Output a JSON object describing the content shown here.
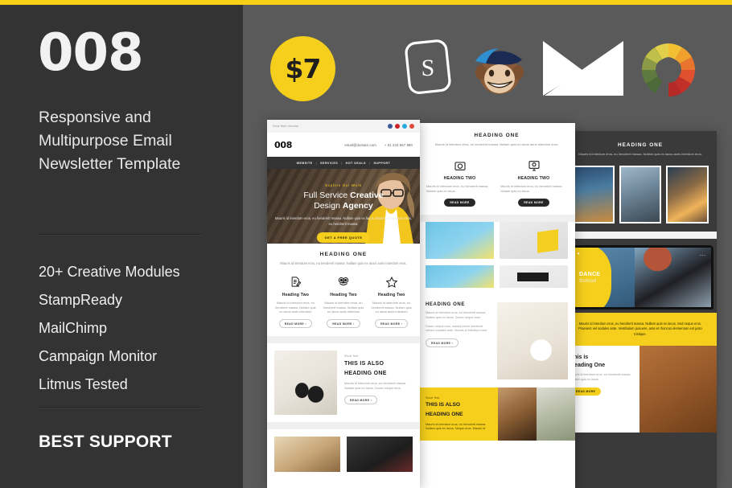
{
  "colors": {
    "accent_yellow": "#f5cf1b",
    "left_panel_bg": "#333333",
    "right_panel_bg": "#5a5a5a",
    "text_light": "#e8e8e8"
  },
  "left_panel": {
    "product_number": "008",
    "tagline": "Responsive and Multipurpose Email Newsletter Template",
    "features": [
      "20+ Creative Modules",
      "StampReady",
      "MailChimp",
      "Campaign Monitor",
      "Litmus Tested"
    ],
    "support_label": "BEST SUPPORT"
  },
  "badges": [
    {
      "name": "price-badge",
      "label": "$7"
    },
    {
      "name": "stampready-badge",
      "label": "S"
    },
    {
      "name": "mailchimp-badge",
      "label": "MailChimp"
    },
    {
      "name": "campaign-monitor-badge",
      "label": "Campaign Monitor"
    },
    {
      "name": "litmus-badge",
      "label": "Litmus"
    }
  ],
  "preview": {
    "main_sheet": {
      "preheader": "View Web Version",
      "social": [
        "facebook",
        "pinterest",
        "twitter",
        "google-plus"
      ],
      "logo": "008",
      "email": "email@domain.com",
      "phone": "+ 01 234 567 890",
      "nav": [
        "WEBSITE",
        "SERVICES",
        "HOT DEALS",
        "SUPPORT"
      ],
      "nav_separator": "|",
      "hero": {
        "eyebrow": "Explore Our Work",
        "title_line1_regular": "Full Service ",
        "title_line1_bold": "Creative",
        "title_line2_regular": "Design ",
        "title_line2_bold": "Agency",
        "body": "Mauris id interdum eros, eu hendrerit massa. Nullam quis ex lacus. Mauris id interdum eros, eu hendrerit massa.",
        "cta": "GET A FREE QUOTE"
      },
      "section": {
        "heading": "HEADING ONE",
        "sub": "Mauris id interdum eros, eu hendrerit massa. Nullam quis ex lacus auris interdum eros.",
        "columns": [
          {
            "icon": "document-pencil-icon",
            "heading": "Heading Two",
            "body": "Mauris id interdum eros, eu hendrerit massa. Nullam quis ex lacus auris interdum",
            "button": "READ MORE  ›"
          },
          {
            "icon": "owl-icon",
            "heading": "Heading Two",
            "body": "Mauris id interdum eros, eu hendrerit massa. Nullam quis ex lacus auris interdum",
            "button": "READ MORE  ›"
          },
          {
            "icon": "star-icon",
            "heading": "Heading Two",
            "body": "Mauris id interdum eros, eu hendrerit massa. Nullam quis ex lacus auris interdum",
            "button": "READ MORE  ›"
          }
        ]
      },
      "feature": {
        "short_text": "Short Text",
        "heading_line1": "THIS IS ALSO",
        "heading_line2": "HEADING ONE",
        "body": "Mauris id interdum eros, eu hendrerit massa. Nullam quis ex lacus. Donec neque eros.",
        "button": "READ MORE  ›",
        "image": "glasses-on-books"
      },
      "duo_images": [
        "warm-interior",
        "desk-scene"
      ]
    },
    "second_sheet": {
      "heading": "HEADING ONE",
      "sub": "Mauris id interdum eros, eu hendrerit massa. Nullam quis ex lacus auris interdum eros.",
      "columns": [
        {
          "icon": "camera-icon",
          "heading": "HEADING TWO",
          "body": "Mauris id interdum eros, eu hendrerit massa. Nullam quis ex lacus.",
          "button": "READ MORE"
        },
        {
          "icon": "monitor-icon",
          "heading": "HEADING TWO",
          "body": "Mauris id interdum eros, eu hendrerit massa. Nullam quis ex lacus.",
          "button": "READ MORE"
        }
      ],
      "grid_images": [
        "paper-plane-cyan",
        "yellow-paper-craft",
        "yellow-laptop-desk"
      ],
      "split": {
        "heading": "HEADING ONE",
        "body1": "Mauris id interdum eros, eu hendrerit massa. Nullam quis ex lacus. Donec neque eros.",
        "body2": "Donec neque eros, massa lorem hendrerit vehore sodales ante. Mauris id interdum eros.",
        "button": "READ MORE  ›",
        "image": "coffee-breakfast"
      },
      "yellow_band": {
        "short_text": "Short Text",
        "heading_line1": "THIS IS ALSO",
        "heading_line2": "HEADING ONE",
        "body": "Mauris id interdum eros, eu hendrerit massa. Nullam quis ex lacus. Neque eros. Mauris id",
        "images": [
          "cat-portrait",
          "potted-plants"
        ]
      }
    },
    "third_sheet": {
      "heading": "HEADING ONE",
      "sub": "Mauris id interdum eros, eu hendrerit massa. Nullam quis ex lacus auris interdum eros.",
      "gallery": [
        "bicycle-sunset",
        "skateboarder-ramp",
        "skater-sunset"
      ],
      "device": {
        "title_bold": "DANCE",
        "title_light": "School",
        "image": "dancer-on-laptop"
      },
      "yellow_text": "Mauris id interdum eros, eu hendrerit massa. Nullam quis ex lacus. Sed neque eros. Praesent vel sodales ante. Vestibulum posuere, ante et rhoncus elementum est justo tristique.",
      "links": [
        "interdum eros,",
        "Vestibulum"
      ],
      "card": {
        "heading_line1": "This is",
        "heading_line2": "Heading One",
        "body": "Mauris id interdum eros, eu hendrerit massa. Nullam quis ex lacus.",
        "button": "READ MORE",
        "image": "leather-backpack"
      }
    }
  }
}
